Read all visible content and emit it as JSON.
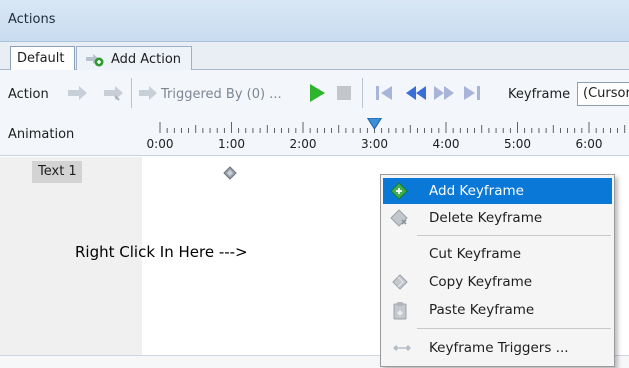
{
  "panel": {
    "title": "Actions"
  },
  "tabs": [
    {
      "label": "Default",
      "active": true
    },
    {
      "label": "Add Action",
      "icon": "add-action-icon"
    }
  ],
  "toolbar": {
    "action_label": "Action",
    "triggered_label": "Triggered By (0) ...",
    "keyframe_label": "Keyframe",
    "keyframe_select": "(Cursor)",
    "animation_label": "Animation",
    "ticks": [
      "0:00",
      "1:00",
      "2:00",
      "3:00",
      "4:00",
      "5:00",
      "6:00"
    ],
    "playhead": "3:00",
    "colors": {
      "play": "#2db52d",
      "navigate": "#3a6fd8",
      "navigate_disabled": "#a8b4d8"
    }
  },
  "timeline": {
    "track": "Text 1",
    "hint": "Right Click In Here  --->"
  },
  "context_menu": {
    "items": [
      {
        "label": "Add Keyframe",
        "icon": "add-keyframe-icon",
        "highlighted": true
      },
      {
        "label": "Delete Keyframe",
        "icon": "delete-keyframe-icon"
      },
      {
        "label": "Cut Keyframe",
        "icon": ""
      },
      {
        "label": "Copy Keyframe",
        "icon": "copy-keyframe-icon"
      },
      {
        "label": "Paste Keyframe",
        "icon": "paste-keyframe-icon"
      },
      {
        "label": "Keyframe Triggers ...",
        "icon": "keyframe-triggers-icon"
      }
    ],
    "colors": {
      "highlight": "#0a78d7"
    }
  }
}
